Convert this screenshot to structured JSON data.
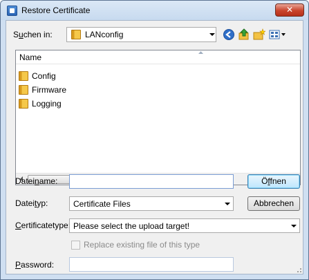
{
  "window": {
    "title": "Restore Certificate",
    "close_label": "✕"
  },
  "lookin": {
    "label_pre": "S",
    "label_u": "u",
    "label_post": "chen in:",
    "value": "LANconfig"
  },
  "listview": {
    "column_name": "Name",
    "items": [
      "Config",
      "Firmware",
      "Logging"
    ],
    "scroll_thumb_label": "III"
  },
  "filename": {
    "label_pre": "Datei",
    "label_u": "n",
    "label_post": "ame:",
    "value": ""
  },
  "filetype": {
    "label_pre": "Datei",
    "label_u": "t",
    "label_post": "yp:",
    "value": "Certificate Files"
  },
  "buttons": {
    "open_pre": "Ö",
    "open_u": "f",
    "open_post": "fnen",
    "cancel": "Abbrechen"
  },
  "certtype": {
    "label_pre": "",
    "label_u": "C",
    "label_post": "ertificatetype:",
    "value": "Please select the upload target!"
  },
  "replace": {
    "label": "Replace existing file of this type",
    "checked": false
  },
  "password": {
    "label_pre": "",
    "label_u": "P",
    "label_post": "assword:",
    "value": ""
  },
  "colors": {
    "titlebar": "#cfdff1",
    "close": "#c9452d",
    "client": "#f0f0f0"
  },
  "icons": [
    "app-icon",
    "folder-icon",
    "back-icon",
    "up-folder-icon",
    "new-folder-icon",
    "view-menu-icon",
    "close-icon"
  ]
}
